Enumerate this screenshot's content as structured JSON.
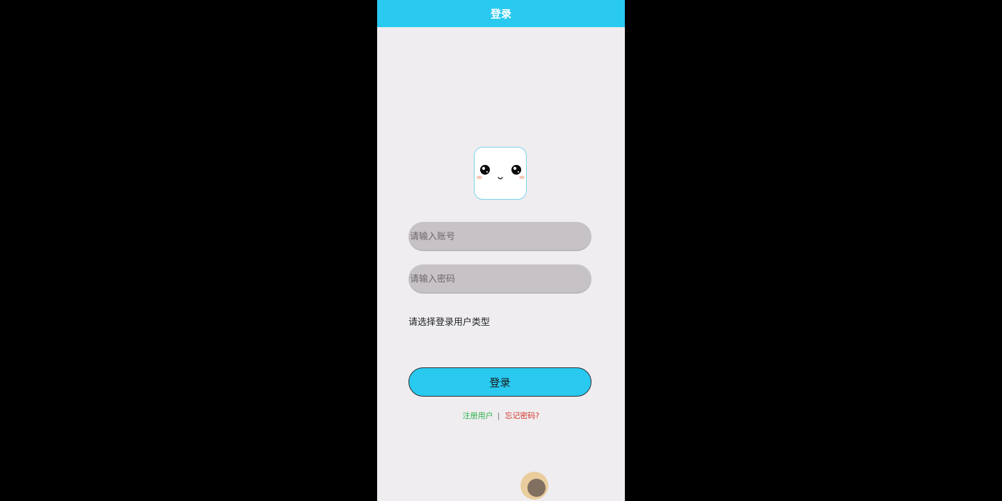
{
  "header": {
    "title": "登录"
  },
  "logo": {
    "icon": "cute-face-icon"
  },
  "form": {
    "account_placeholder": "请输入账号",
    "password_placeholder": "请输入密码",
    "user_type_label": "请选择登录用户类型",
    "login_label": "登录"
  },
  "links": {
    "register": "注册用户",
    "separator": "|",
    "forgot": "忘记密码?"
  },
  "colors": {
    "accent": "#29c9f0",
    "background": "#efedf0",
    "input_bg": "#c6c2c6",
    "register_link": "#2db34a",
    "forgot_link": "#d6362c"
  }
}
